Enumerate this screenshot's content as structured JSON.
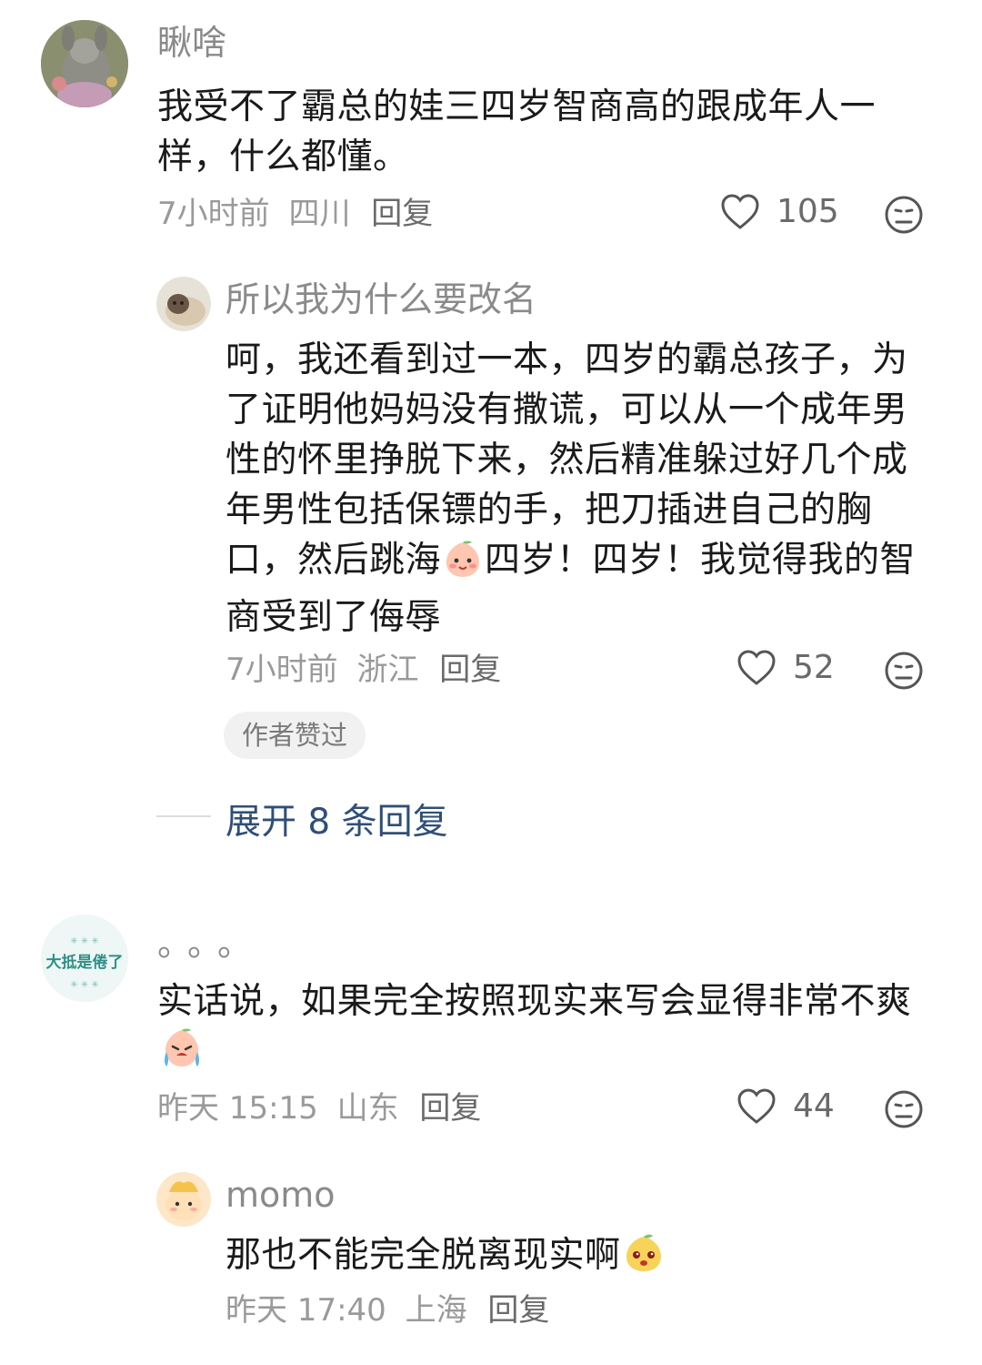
{
  "comments": [
    {
      "username": "瞅啥",
      "text": "我受不了霸总的娃三四岁智商高的跟成年人一样，什么都懂。",
      "time": "7小时前",
      "location": "四川",
      "reply_label": "回复",
      "likes": "105",
      "icons": {
        "like": "heart-outline-icon",
        "dislike": "meh-face-icon"
      }
    },
    {
      "username": "所以我为什么要改名",
      "text_before_emoji": "呵，我还看到过一本，四岁的霸总孩子，为了证明他妈妈没有撒谎，可以从一个成年男性的怀里挣脱下来，然后精准躲过好几个成年男性包括保镖的手，把刀插进自己的胸口，然后跳海",
      "text_after_emoji": "四岁！四岁！我觉得我的智商受到了侮辱",
      "time": "7小时前",
      "location": "浙江",
      "reply_label": "回复",
      "likes": "52",
      "badge": "作者赞过"
    },
    {
      "expand_label": "展开 8 条回复"
    },
    {
      "username": "。。。",
      "text_before_emoji": "实话说，如果完全按照现实来写会显得非常不爽",
      "time": "昨天 15:15",
      "location": "山东",
      "reply_label": "回复",
      "likes": "44"
    },
    {
      "username": "momo",
      "text_before_emoji": "那也不能完全脱离现实啊",
      "time": "昨天 17:40",
      "location": "上海",
      "reply_label": "回复"
    }
  ],
  "avatar2_caption": "大抵是倦了",
  "colors": {
    "link": "#2f4f78",
    "meta": "#9a9a9a",
    "badge_bg": "#f1f1f1"
  }
}
